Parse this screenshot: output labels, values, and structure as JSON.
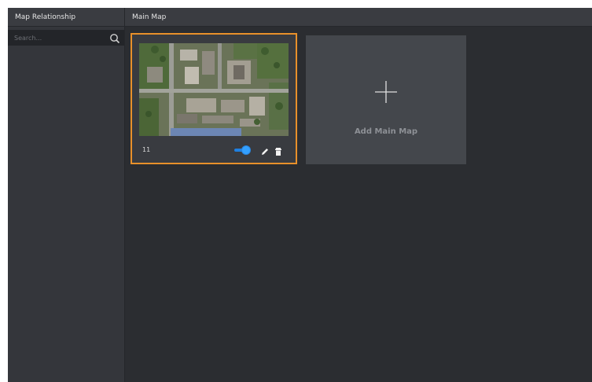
{
  "sidebar": {
    "title": "Map Relationship",
    "search": {
      "placeholder": "Search...",
      "value": ""
    }
  },
  "main": {
    "title": "Main Map",
    "maps": [
      {
        "name": "11",
        "enabled": true
      }
    ],
    "add_label": "Add Main Map"
  },
  "colors": {
    "selected_border": "#e8902a",
    "toggle_on": "#1f7fe0",
    "background": "#2b2d31"
  },
  "icons": [
    "search-icon",
    "toggle-switch",
    "pencil-icon",
    "trash-icon",
    "plus-icon"
  ]
}
